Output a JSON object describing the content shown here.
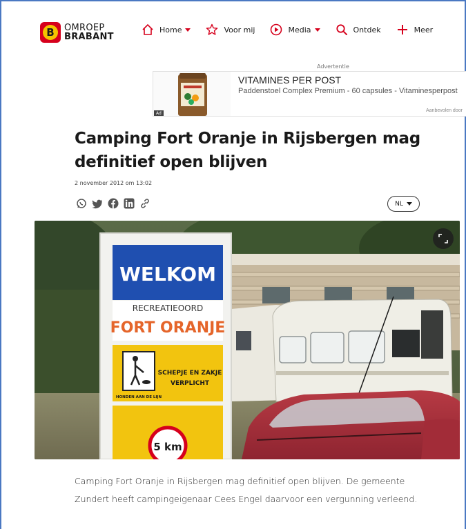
{
  "brand": {
    "line1": "OMROEP",
    "line2": "BRABANT",
    "mark": "B",
    "color": "#d6001c",
    "mark_color": "#f4c400"
  },
  "nav": [
    {
      "label": "Home",
      "icon": "home-icon",
      "has_caret": true
    },
    {
      "label": "Voor mij",
      "icon": "star-icon",
      "has_caret": false
    },
    {
      "label": "Media",
      "icon": "play-icon",
      "has_caret": true
    },
    {
      "label": "Ontdek",
      "icon": "search-icon",
      "has_caret": false
    },
    {
      "label": "Meer",
      "icon": "plus-icon",
      "has_caret": false
    }
  ],
  "ad": {
    "label": "Advertentie",
    "title": "VITAMINES PER POST",
    "subtitle": "Paddenstoel Complex Premium - 60 capsules - Vitaminesperpost",
    "footer": "Aanbevolen door",
    "badge": "Ad"
  },
  "article": {
    "title": "Camping Fort Oranje in Rijsbergen mag definitief open blijven",
    "date": "2 november 2012 om 13:02",
    "language": "NL",
    "share_icons": [
      "whatsapp-icon",
      "twitter-icon",
      "facebook-icon",
      "linkedin-icon",
      "link-icon"
    ],
    "photo": {
      "sign_welcome": "WELKOM",
      "sign_recreatie": "RECREATIEOORD",
      "sign_name": "FORT ORANJE",
      "sign_notice_1": "SCHEPJE EN ZAKJE",
      "sign_notice_2": "VERPLICHT",
      "sign_notice_3": "HONDEN AAN DE LIJN",
      "sign_speed": "5 km"
    },
    "body": "Camping Fort Oranje in Rijsbergen mag definitief open blijven. De gemeente Zundert heeft campingeigenaar Cees Engel daarvoor een vergunning verleend."
  }
}
